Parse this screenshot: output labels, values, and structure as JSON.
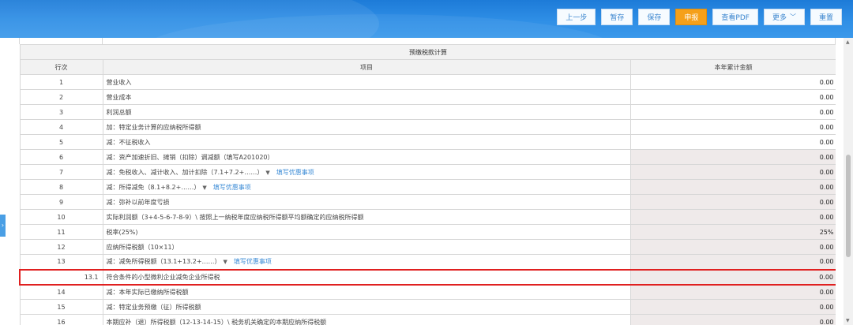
{
  "toolbar": {
    "buttons": {
      "prev": "上一步",
      "draft": "暂存",
      "save": "保存",
      "submit": "申报",
      "pdf": "查看PDF",
      "more": "更多",
      "reset": "重置"
    }
  },
  "table": {
    "section_title": "预缴税款计算",
    "headers": [
      "行次",
      "项目",
      "本年累计金额"
    ],
    "pref_link": "填写优惠事项",
    "rows": [
      {
        "no": "1",
        "item": "营业收入",
        "amount": "0.00"
      },
      {
        "no": "2",
        "item": "营业成本",
        "amount": "0.00"
      },
      {
        "no": "3",
        "item": "利润总额",
        "amount": "0.00"
      },
      {
        "no": "4",
        "item": "加：特定业务计算的应纳税所得额",
        "amount": "0.00"
      },
      {
        "no": "5",
        "item": "减：不征税收入",
        "amount": "0.00"
      },
      {
        "no": "6",
        "item": "减：资产加速折旧、摊销（扣除）调减额（填写A201020）",
        "amount": "0.00"
      },
      {
        "no": "7",
        "item": "减：免税收入、减计收入、加计扣除（7.1+7.2+……）",
        "amount": "0.00"
      },
      {
        "no": "8",
        "item": "减：所得减免（8.1+8.2+……）",
        "amount": "0.00"
      },
      {
        "no": "9",
        "item": "减：弥补以前年度亏损",
        "amount": "0.00"
      },
      {
        "no": "10",
        "item": "实际利润额（3+4-5-6-7-8-9）\\ 按照上一纳税年度应纳税所得额平均额确定的应纳税所得额",
        "amount": "0.00"
      },
      {
        "no": "11",
        "item": "税率(25%)",
        "amount": "25%"
      },
      {
        "no": "12",
        "item": "应纳所得税额（10×11）",
        "amount": "0.00"
      },
      {
        "no": "13",
        "item": "减：减免所得税额（13.1+13.2+……）",
        "amount": "0.00"
      },
      {
        "no": "13.1",
        "item": "符合条件的小型微利企业减免企业所得税",
        "amount": "0.00"
      },
      {
        "no": "14",
        "item": "减：本年实际已缴纳所得税额",
        "amount": "0.00"
      },
      {
        "no": "15",
        "item": "减：特定业务预缴（征）所得税额",
        "amount": "0.00"
      },
      {
        "no": "16",
        "item": "本期应补（退）所得税额（12-13-14-15）\\ 税务机关确定的本期应纳所得税额",
        "amount": "0.00"
      }
    ]
  },
  "colors": {
    "toolbar": "#2f8fe6",
    "submit_button": "#f5a01a",
    "highlight_border": "#e02020",
    "readonly_cell": "#efeaea",
    "link": "#3b8bd6"
  }
}
